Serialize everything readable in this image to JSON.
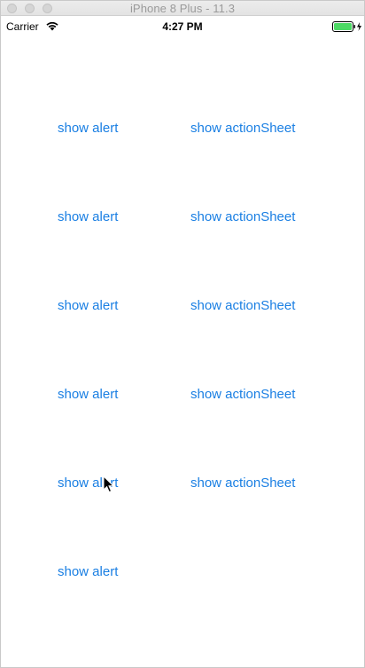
{
  "window": {
    "title": "iPhone 8 Plus - 11.3"
  },
  "status_bar": {
    "carrier": "Carrier",
    "time": "4:27 PM",
    "icons": [
      "wifi-icon",
      "battery-charging-icon"
    ]
  },
  "colors": {
    "link": "#1a7fe3",
    "battery_fill": "#4cd964"
  },
  "buttons": {
    "alert_label": "show alert",
    "action_sheet_label": "show actionSheet"
  }
}
